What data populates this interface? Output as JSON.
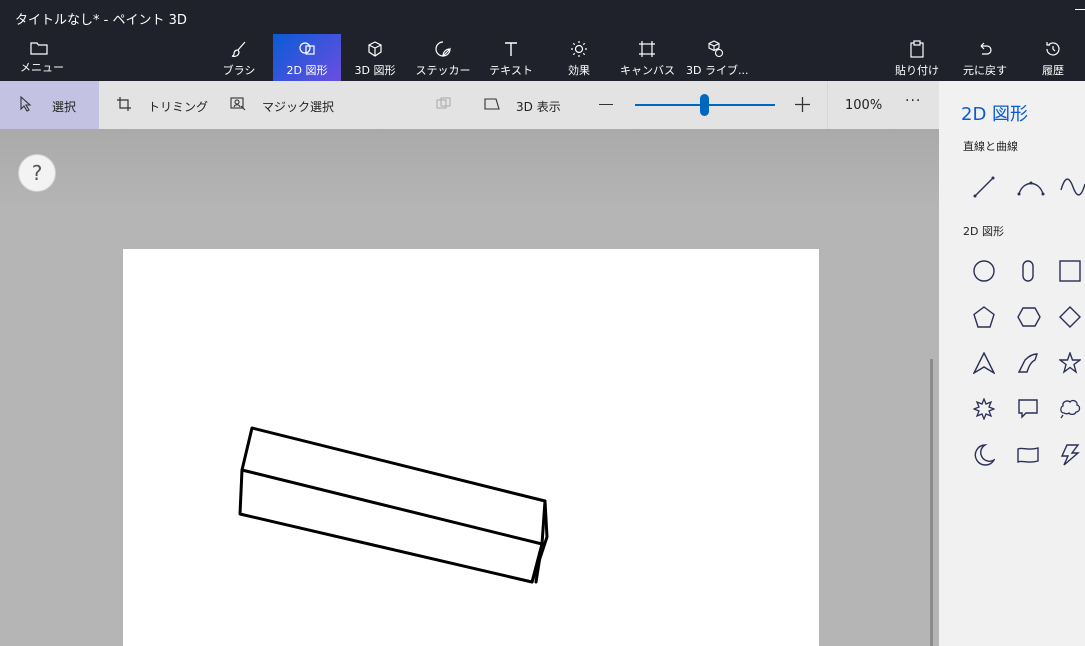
{
  "window": {
    "title": "タイトルなし* - ペイント 3D"
  },
  "toolbar": {
    "menu": "メニュー",
    "brushes": "ブラシ",
    "shapes2d": "2D 図形",
    "shapes3d": "3D 図形",
    "stickers": "ステッカー",
    "text": "テキスト",
    "effects": "効果",
    "canvas": "キャンバス",
    "library3d": "3D ライブ...",
    "paste": "貼り付け",
    "undo": "元に戻す",
    "history": "履歴",
    "active_tab": "2D 図形",
    "accent_color": "#0a5bd6"
  },
  "subbar": {
    "select": "選択",
    "trimming": "トリミング",
    "magic_select": "マジック選択",
    "view3d": "3D 表示",
    "zoom_value": "100%",
    "zoom_level": 0.5,
    "more": "···"
  },
  "workspace": {
    "help": "?"
  },
  "panel": {
    "title": "2D 図形",
    "lines_label": "直線と曲線",
    "shapes_label": "2D 図形",
    "line_tools": [
      "line-icon",
      "curve-icon",
      "wave-icon"
    ],
    "shape_tools": [
      "circle-icon",
      "rounded-rect-icon",
      "square-icon",
      "pentagon-icon",
      "hexagon-icon",
      "diamond-icon",
      "triangle-icon",
      "quarter-arc-icon",
      "star-icon",
      "burst-icon",
      "speech-bubble-icon",
      "thought-bubble-icon",
      "crescent-icon",
      "banner-icon",
      "lightning-icon"
    ]
  }
}
